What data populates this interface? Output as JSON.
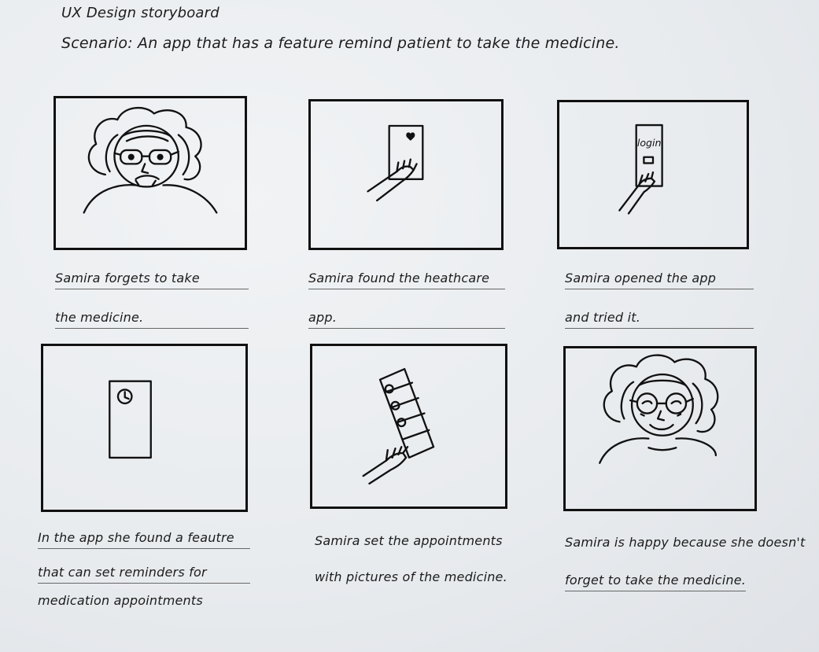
{
  "heading": "UX Design storyboard",
  "scenario": "Scenario: An app that has a feature remind patient to take the medicine.",
  "panels": [
    {
      "caption_line1": "Samira forgets to take",
      "caption_line2": "the medicine."
    },
    {
      "caption_line1": "Samira found the heathcare",
      "caption_line2": "app."
    },
    {
      "caption_line1": "Samira opened the app",
      "caption_line2": "and tried it."
    },
    {
      "caption_line1": "In the app she found a feautre",
      "caption_line2": "that can set reminders for",
      "caption_line3": "medication appointments"
    },
    {
      "caption_line1": "Samira set the appointments",
      "caption_line2": "with pictures of the medicine."
    },
    {
      "caption_line1": "Samira is happy because she doesn't",
      "caption_line2": "forget to take the medicine."
    }
  ],
  "phone_login_text": "login"
}
